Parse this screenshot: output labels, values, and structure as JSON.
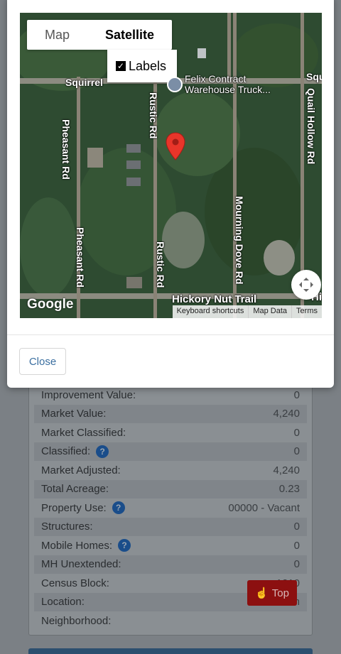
{
  "map": {
    "type_options": [
      "Map",
      "Satellite"
    ],
    "active_type": "Satellite",
    "labels_label": "Labels",
    "labels_checked": true,
    "roads": {
      "squirrel": "Squirrel",
      "squirrel_right": "Squ",
      "pheasant_top": "Pheasant Rd",
      "pheasant_bottom": "Pheasant Rd",
      "rustic_top": "Rustic Rd",
      "rustic_bottom": "Rustic Rd",
      "mourning_dove": "Mourning Dove Rd",
      "quail_hollow": "Quail Hollow Rd",
      "hickory": "Hickory Nut Trail",
      "hickory_right": "Hi"
    },
    "poi_line1": "Felix Contract",
    "poi_line2": "Warehouse Truck...",
    "google_logo": "Google",
    "attribution": [
      "Keyboard shortcuts",
      "Map Data",
      "Terms"
    ]
  },
  "modal": {
    "close_label": "Close"
  },
  "property": [
    {
      "label": "Improvement Value:",
      "value": "0",
      "help": false
    },
    {
      "label": "Market Value:",
      "value": "4,240",
      "help": false
    },
    {
      "label": "Market Classified:",
      "value": "0",
      "help": false
    },
    {
      "label": "Classified:",
      "value": "0",
      "help": true
    },
    {
      "label": "Market Adjusted:",
      "value": "4,240",
      "help": false
    },
    {
      "label": "Total Acreage:",
      "value": "0.23",
      "help": false
    },
    {
      "label": "Property Use:",
      "value": "00000 - Vacant",
      "help": true
    },
    {
      "label": "Structures:",
      "value": "0",
      "help": false
    },
    {
      "label": "Mobile Homes:",
      "value": "0",
      "help": true
    },
    {
      "label": "MH Unextended:",
      "value": "0",
      "help": false
    },
    {
      "label": "Census Block:",
      "value": "1210",
      "help": false
    },
    {
      "label": "Location:",
      "value": "Putn",
      "help": false
    },
    {
      "label": "Neighborhood:",
      "value": "",
      "help": false
    }
  ],
  "top_button": {
    "label": "Top"
  }
}
